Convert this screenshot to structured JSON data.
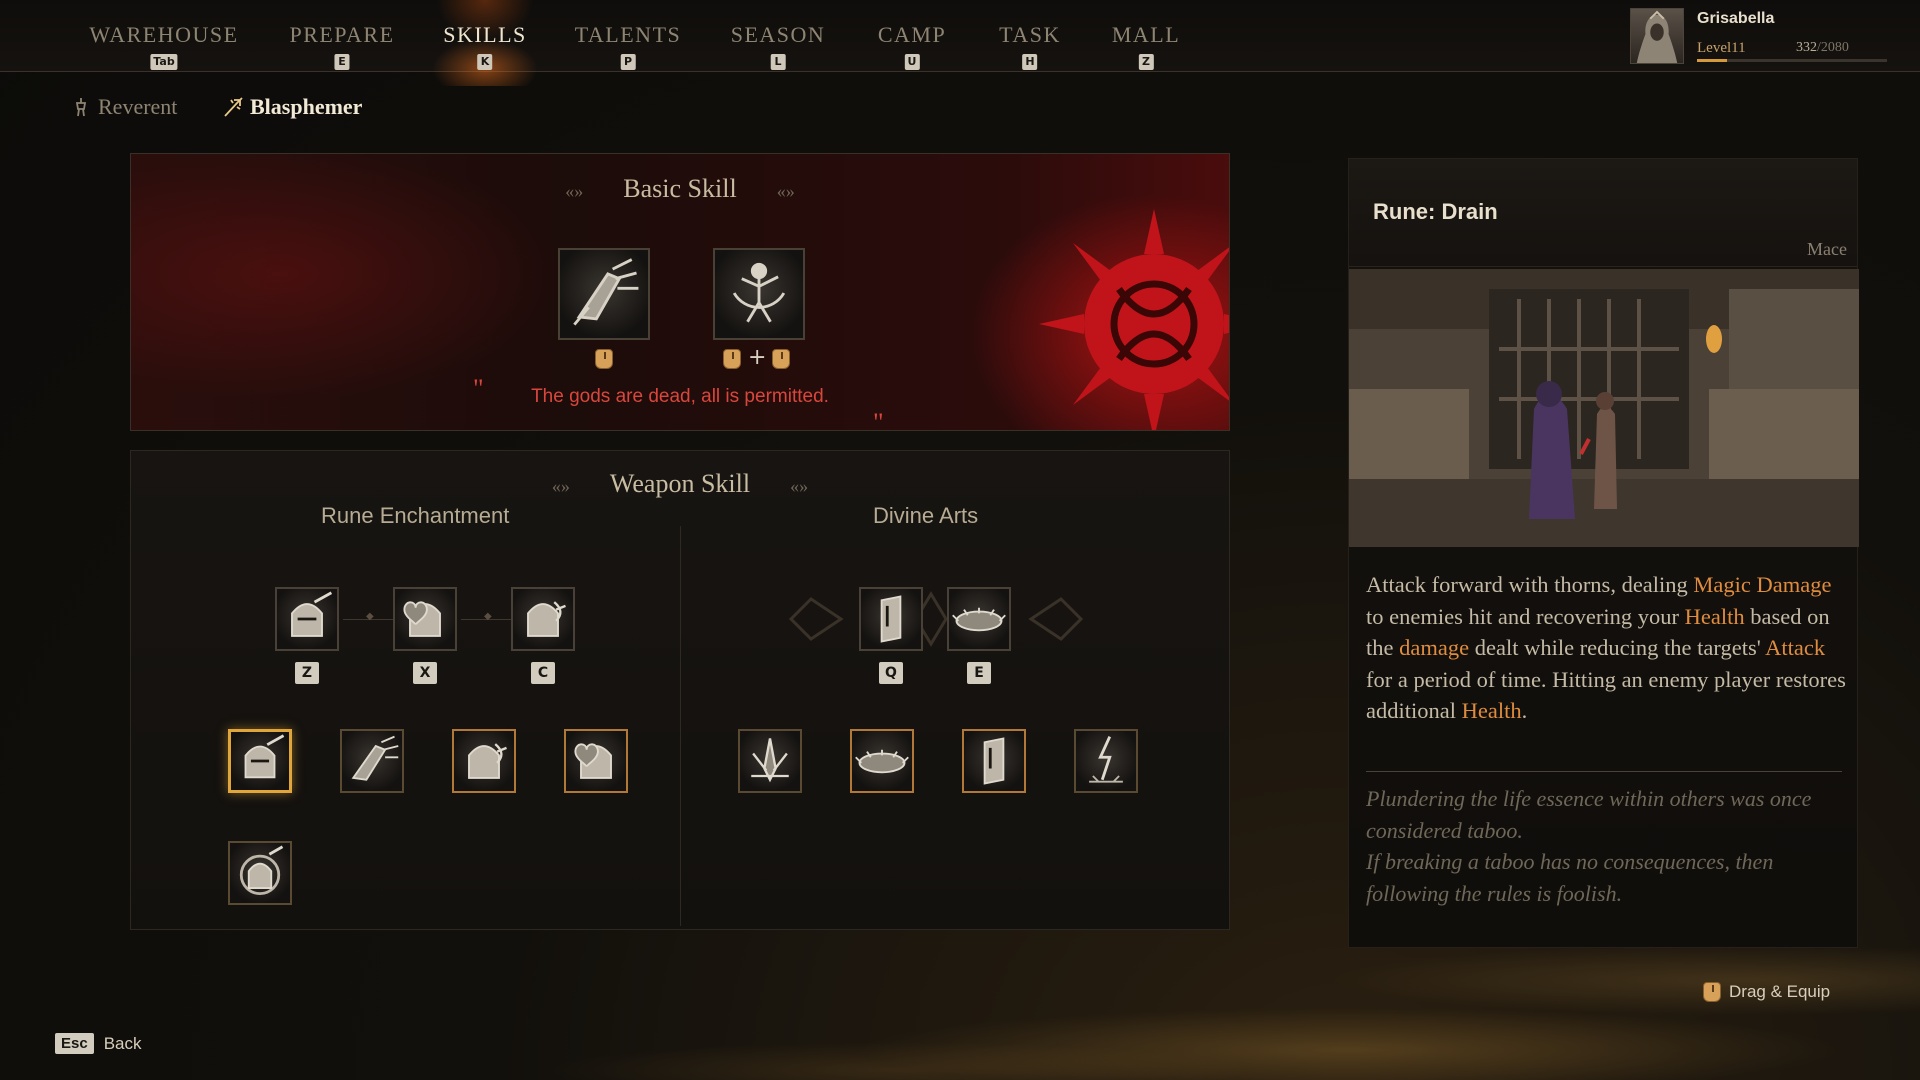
{
  "nav": {
    "tabs": [
      {
        "label": "WAREHOUSE",
        "key": "Tab"
      },
      {
        "label": "PREPARE",
        "key": "E"
      },
      {
        "label": "SKILLS",
        "key": "K"
      },
      {
        "label": "TALENTS",
        "key": "P"
      },
      {
        "label": "SEASON",
        "key": "L"
      },
      {
        "label": "CAMP",
        "key": "U"
      },
      {
        "label": "TASK",
        "key": "H"
      },
      {
        "label": "MALL",
        "key": "Z"
      }
    ],
    "active": "SKILLS"
  },
  "player": {
    "name": "Grisabella",
    "level": "Level11",
    "xp": "332",
    "xp_max": "/2080",
    "xp_fraction": 0.16
  },
  "classes": {
    "reverent": "Reverent",
    "blasphemer": "Blasphemer",
    "active": "Blasphemer"
  },
  "basic_skill": {
    "title": "Basic Skill",
    "quote": "The gods are dead, all is permitted.",
    "open_quote": "\"",
    "close_quote": "\"",
    "plus": "+"
  },
  "weapon_skill": {
    "title": "Weapon Skill",
    "rune_enchantment": {
      "title": "Rune Enchantment",
      "keys": [
        "Z",
        "X",
        "C"
      ]
    },
    "divine_arts": {
      "title": "Divine Arts",
      "keys": [
        "Q",
        "E"
      ]
    }
  },
  "detail": {
    "title": "Rune: Drain",
    "weapon": "Mace",
    "desc": {
      "p1": "Attack forward with thorns, dealing ",
      "h1": "Magic Damage",
      "p2": " to enemies hit and recovering your ",
      "h2": "Health",
      "p3": " based on the ",
      "h3": "damage",
      "p4": " dealt while reducing the targets' ",
      "h4": "Attack",
      "p5": " for a period of time. Hitting an enemy player restores additional ",
      "h5": "Health",
      "p6": "."
    },
    "lore": "Plundering the life essence within others was once considered taboo.\nIf breaking a taboo has no consequences, then following the rules is foolish."
  },
  "footer": {
    "drag_equip": "Drag & Equip",
    "esc": "Esc",
    "back": "Back"
  },
  "colors": {
    "accent": "#df8c3e",
    "quote_red": "#d9463c",
    "selected_border": "#e0a63a"
  },
  "icons": [
    "thorn-claw-icon",
    "warrior-spin-icon",
    "knight-helm-slash-icon",
    "knight-helm-heart-icon",
    "knight-helm-rune-icon",
    "tome-icon",
    "thorn-nest-icon",
    "spike-burst-icon",
    "lightning-strike-icon",
    "mouse-icon"
  ]
}
